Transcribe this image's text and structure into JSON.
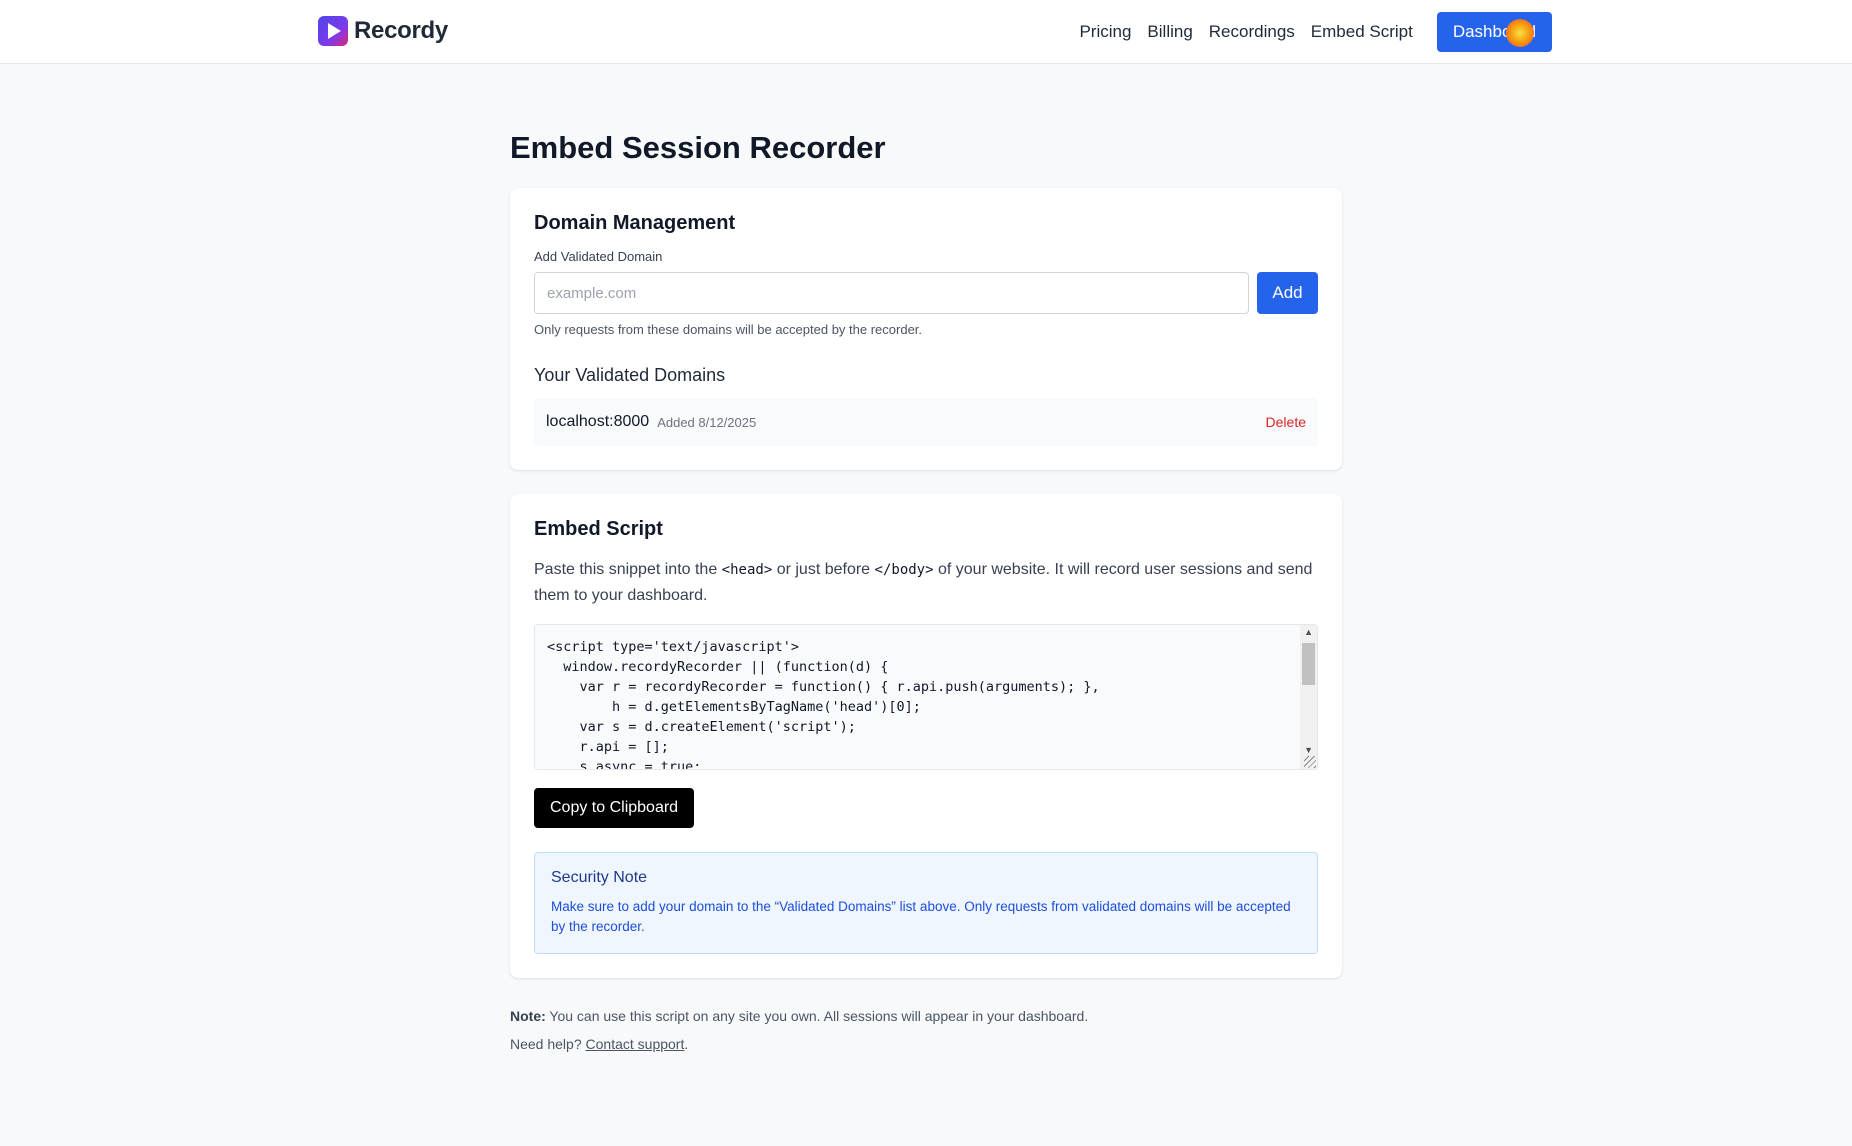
{
  "app": {
    "brand": "Recordy"
  },
  "nav": {
    "items": [
      "Pricing",
      "Billing",
      "Recordings",
      "Embed Script"
    ],
    "dashboard_label": "Dashboard"
  },
  "page": {
    "title": "Embed Session Recorder"
  },
  "domain_management": {
    "title": "Domain Management",
    "field_label": "Add Validated Domain",
    "placeholder": "example.com",
    "add_label": "Add",
    "help": "Only requests from these domains will be accepted by the recorder.",
    "list_title": "Your Validated Domains",
    "domains": [
      {
        "name": "localhost:8000",
        "added": "Added 8/12/2025",
        "delete_label": "Delete"
      }
    ]
  },
  "embed": {
    "title": "Embed Script",
    "desc_1": "Paste this snippet into the ",
    "code_head": "<head>",
    "desc_2": " or just before ",
    "code_body": "</body>",
    "desc_3": " of your website. It will record user sessions and send them to your dashboard.",
    "snippet": "<script type='text/javascript'>\n  window.recordyRecorder || (function(d) {\n    var r = recordyRecorder = function() { r.api.push(arguments); },\n        h = d.getElementsByTagName('head')[0];\n    var s = d.createElement('script');\n    r.api = [];\n    s.async = true;",
    "copy_label": "Copy to Clipboard",
    "security_title": "Security Note",
    "security_text": "Make sure to add your domain to the “Validated Domains” list above. Only requests from validated domains will be accepted by the recorder."
  },
  "footer": {
    "note_label": "Note:",
    "note_text": " You can use this script on any site you own. All sessions will appear in your dashboard.",
    "help_prefix": "Need help? ",
    "contact_label": "Contact support",
    "help_suffix": "."
  },
  "colors": {
    "primary": "#2563eb",
    "danger": "#dc2626",
    "note_bg": "#eff6ff"
  }
}
